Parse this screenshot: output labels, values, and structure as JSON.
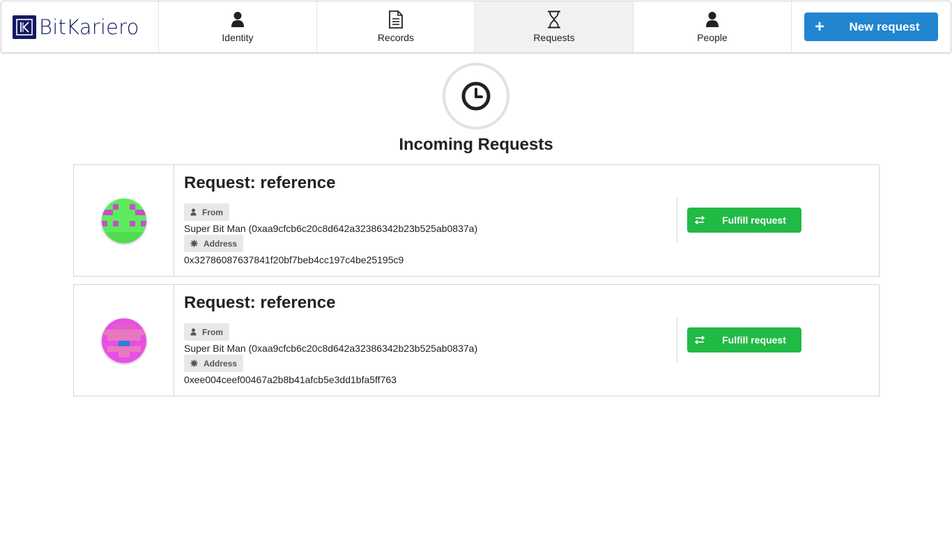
{
  "brand": {
    "name": "BitKariero",
    "color": "#141b63"
  },
  "nav": {
    "items": [
      {
        "label": "Identity",
        "icon": "user-icon",
        "active": false
      },
      {
        "label": "Records",
        "icon": "file-text-icon",
        "active": false
      },
      {
        "label": "Requests",
        "icon": "hourglass-icon",
        "active": true
      },
      {
        "label": "People",
        "icon": "user-icon",
        "active": false
      }
    ],
    "new_request": {
      "label": "New request",
      "icon": "plus-icon",
      "color": "#2185d0"
    }
  },
  "page": {
    "title": "Incoming Requests",
    "icon": "clock-icon"
  },
  "requests": [
    {
      "title": "Request: reference",
      "from_label": "From",
      "from_value": "Super Bit Man (0xaa9cfcb6c20c8d642a32386342b23b525ab0837a)",
      "address_label": "Address",
      "address_value": "0x32786087637841f20bf7beb4cc197c4be25195c9",
      "action_label": "Fulfill request",
      "avatar_icon": "identicon-green",
      "avatar_color": "#5cec5c"
    },
    {
      "title": "Request: reference",
      "from_label": "From",
      "from_value": "Super Bit Man (0xaa9cfcb6c20c8d642a32386342b23b525ab0837a)",
      "address_label": "Address",
      "address_value": "0xee004ceef00467a2b8b41afcb5e3dd1bfa5ff763",
      "action_label": "Fulfill request",
      "avatar_icon": "identicon-pink",
      "avatar_color": "#e94fe5"
    }
  ],
  "colors": {
    "action": "#21ba45",
    "active_tab": "#f2f2f2"
  }
}
